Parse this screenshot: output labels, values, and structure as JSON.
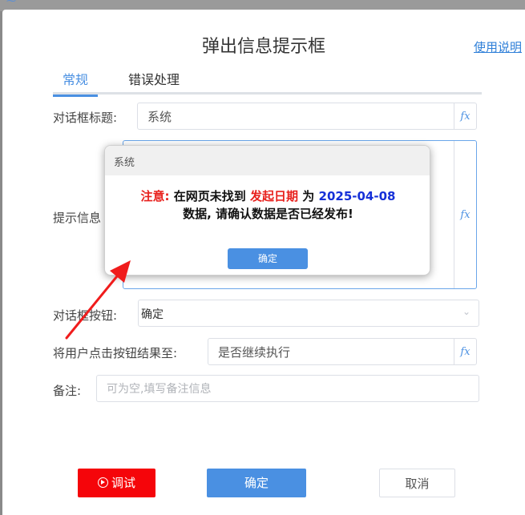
{
  "dialog": {
    "title": "弹出信息提示框",
    "help_link": "使用说明"
  },
  "tabs": [
    {
      "label": "常规",
      "active": true
    },
    {
      "label": "错误处理",
      "active": false
    }
  ],
  "form": {
    "dialog_title_label": "对话框标题:",
    "dialog_title_value": "系统",
    "message_label": "提示信息",
    "button_label": "对话框按钮:",
    "button_value": "确定",
    "save_result_label": "将用户点击按钮结果至:",
    "save_result_value": "是否继续执行",
    "note_label": "备注:",
    "note_placeholder": "可为空,填写备注信息"
  },
  "fx_label": "fx",
  "popup": {
    "title": "系统",
    "msg_prefix": "注意:",
    "msg_part1": "在网页未找到",
    "msg_highlight": "发起日期",
    "msg_part2": "为",
    "msg_date": "2025-04-08",
    "msg_line2": "数据, 请确认数据是否已经发布!",
    "ok_button": "确定"
  },
  "footer": {
    "debug_button": "调试",
    "ok_button": "确定",
    "cancel_button": "取消"
  },
  "colors": {
    "accent": "#4a90e2",
    "danger": "#f5050a",
    "highlight_red": "#e8211d",
    "highlight_blue": "#1530d8"
  }
}
